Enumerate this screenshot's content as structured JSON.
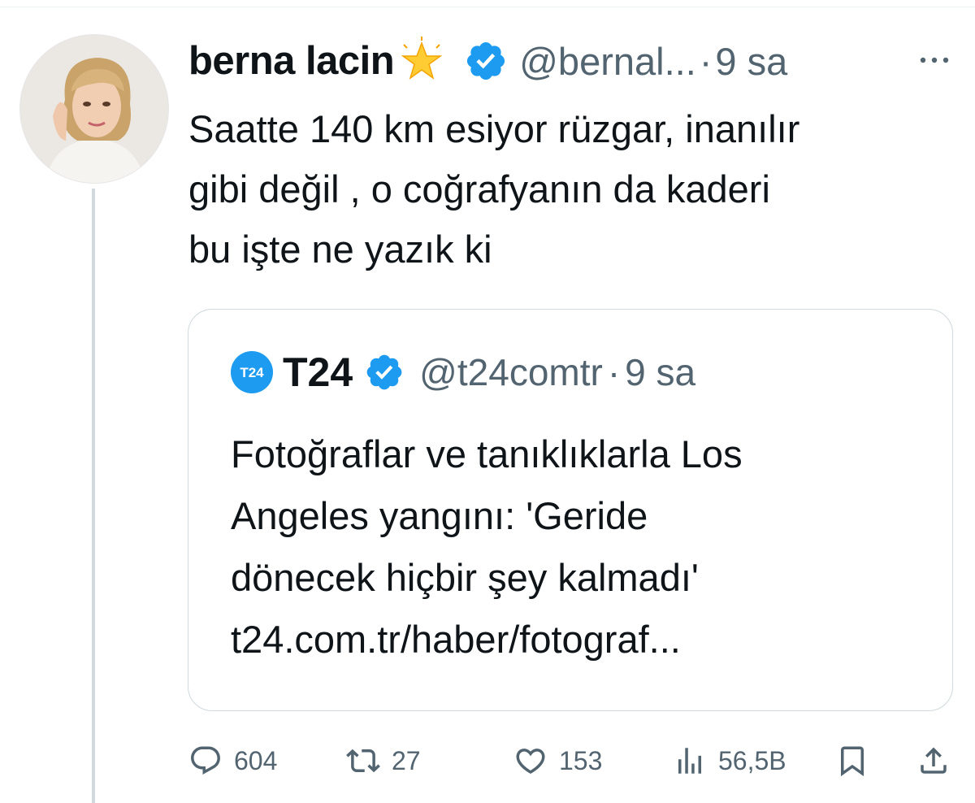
{
  "tweet": {
    "author_name": "berna lacin",
    "author_emoji": "glowing-star-icon",
    "author_handle": "@bernal...",
    "separator": "·",
    "time": "9 sa",
    "text_lines": [
      "Saatte 140 km esiyor rüzgar, inanılır",
      "gibi değil , o coğrafyanın da kaderi",
      "bu işte ne yazık ki"
    ]
  },
  "quote": {
    "logo_text": "T24",
    "name": "T24",
    "handle": "@t24comtr",
    "separator": "·",
    "time": "9 sa",
    "text_lines": [
      "Fotoğraflar ve tanıklıklarla Los",
      "Angeles yangını: 'Geride",
      "dönecek hiçbir şey kalmadı'",
      "t24.com.tr/haber/fotograf..."
    ]
  },
  "actions": {
    "replies": "604",
    "reposts": "27",
    "likes": "153",
    "views": "56,5B"
  },
  "colors": {
    "verified": "#1d9bf0",
    "secondary_text": "#536471",
    "border": "#cfd9de"
  }
}
